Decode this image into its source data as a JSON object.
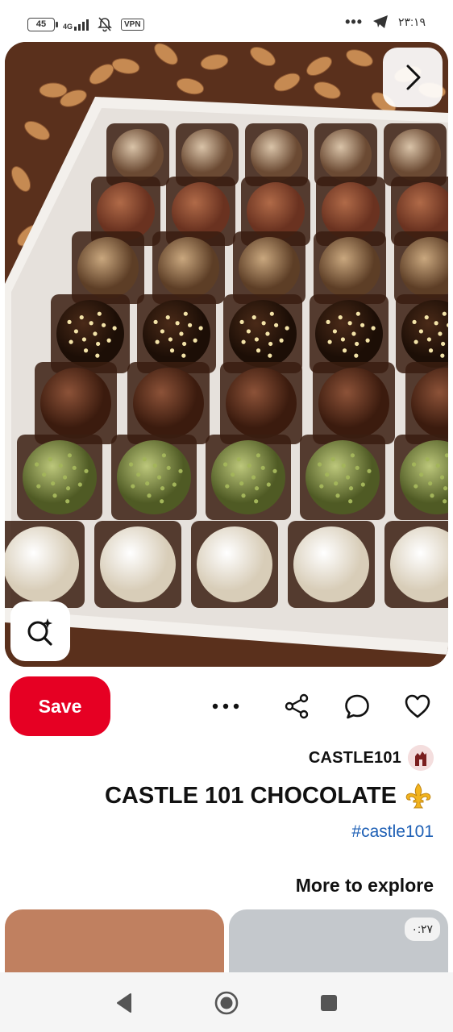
{
  "status_bar": {
    "battery": "45",
    "network": "4G",
    "vpn": "VPN",
    "overflow": "•••",
    "time": "۲۳:۱۹"
  },
  "pin": {
    "save_label": "Save",
    "more_icon": "more-horizontal-icon",
    "share_icon": "share-icon",
    "comment_icon": "comment-icon",
    "like_icon": "heart-icon",
    "creator": "CASTLE101",
    "title": "CASTLE 101 CHOCOLATE",
    "title_emoji": "⚜️",
    "hashtag": "#castle101"
  },
  "explore": {
    "heading": "More to explore",
    "cards": [
      {
        "color": "#c08060"
      },
      {
        "color": "#c4c8cc",
        "duration": "۰:۲۷"
      }
    ]
  },
  "colors": {
    "accent": "#e60023",
    "link": "#1d5fb5"
  }
}
